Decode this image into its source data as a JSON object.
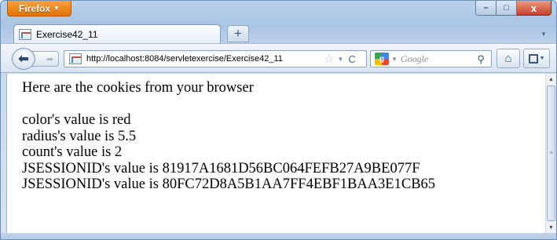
{
  "browser": {
    "menu_button_label": "Firefox",
    "window_controls": {
      "minimize": "–",
      "maximize": "□",
      "close": "x"
    }
  },
  "tabs": [
    {
      "title": "Exercise42_11",
      "active": true
    }
  ],
  "new_tab_label": "+",
  "navigation": {
    "url": "http://localhost:8084/servletexercise/Exercise42_11",
    "search_engine_placeholder": "Google"
  },
  "page": {
    "heading": "Here are the cookies from your browser",
    "cookies": [
      "color's value is red",
      "radius's value is 5.5",
      "count's value is 2",
      "JSESSIONID's value is 81917A1681D56BC064FEFB27A9BE077F",
      "JSESSIONID's value is 80FC72D8A5B1AA7FF4EBF1BAA3E1CB65"
    ]
  },
  "colors": {
    "firefox_button": "#e2740a",
    "frame": "#b9d1ea",
    "close_button": "#c7412a"
  }
}
